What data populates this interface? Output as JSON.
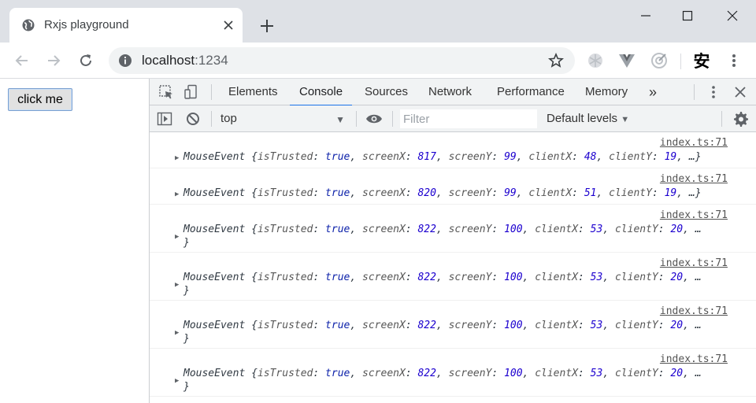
{
  "browser": {
    "tab_title": "Rxjs playground",
    "url_host": "localhost",
    "url_port": ":1234",
    "ext_cjk_char": "安"
  },
  "page": {
    "button_label": "click me"
  },
  "devtools": {
    "tabs": [
      "Elements",
      "Console",
      "Sources",
      "Network",
      "Performance",
      "Memory"
    ],
    "active_tab": "Console",
    "more_tabs_glyph": "»",
    "context": "top",
    "filter_placeholder": "Filter",
    "levels_label": "Default levels",
    "accent_color": "#1a73e8"
  },
  "console": {
    "messages": [
      {
        "source": "index.ts:71",
        "class": "MouseEvent",
        "screenX": "817",
        "screenY": "99",
        "clientX": "48",
        "clientY": "19",
        "ending": ", …}",
        "wrapped": false
      },
      {
        "source": "index.ts:71",
        "class": "MouseEvent",
        "screenX": "820",
        "screenY": "99",
        "clientX": "51",
        "clientY": "19",
        "ending": ", …}",
        "wrapped": false
      },
      {
        "source": "index.ts:71",
        "class": "MouseEvent",
        "screenX": "822",
        "screenY": "100",
        "clientX": "53",
        "clientY": "20",
        "ending": ", …",
        "wrapped": true
      },
      {
        "source": "index.ts:71",
        "class": "MouseEvent",
        "screenX": "822",
        "screenY": "100",
        "clientX": "53",
        "clientY": "20",
        "ending": ", …",
        "wrapped": true
      },
      {
        "source": "index.ts:71",
        "class": "MouseEvent",
        "screenX": "822",
        "screenY": "100",
        "clientX": "53",
        "clientY": "20",
        "ending": ", …",
        "wrapped": true
      },
      {
        "source": "index.ts:71",
        "class": "MouseEvent",
        "screenX": "822",
        "screenY": "100",
        "clientX": "53",
        "clientY": "20",
        "ending": ", …",
        "wrapped": true
      }
    ],
    "labels": {
      "is_trusted_key": "isTrusted",
      "is_trusted_value": "true",
      "screen_x_key": "screenX",
      "screen_y_key": "screenY",
      "client_x_key": "clientX",
      "client_y_key": "clientY",
      "close_brace": "}"
    }
  }
}
